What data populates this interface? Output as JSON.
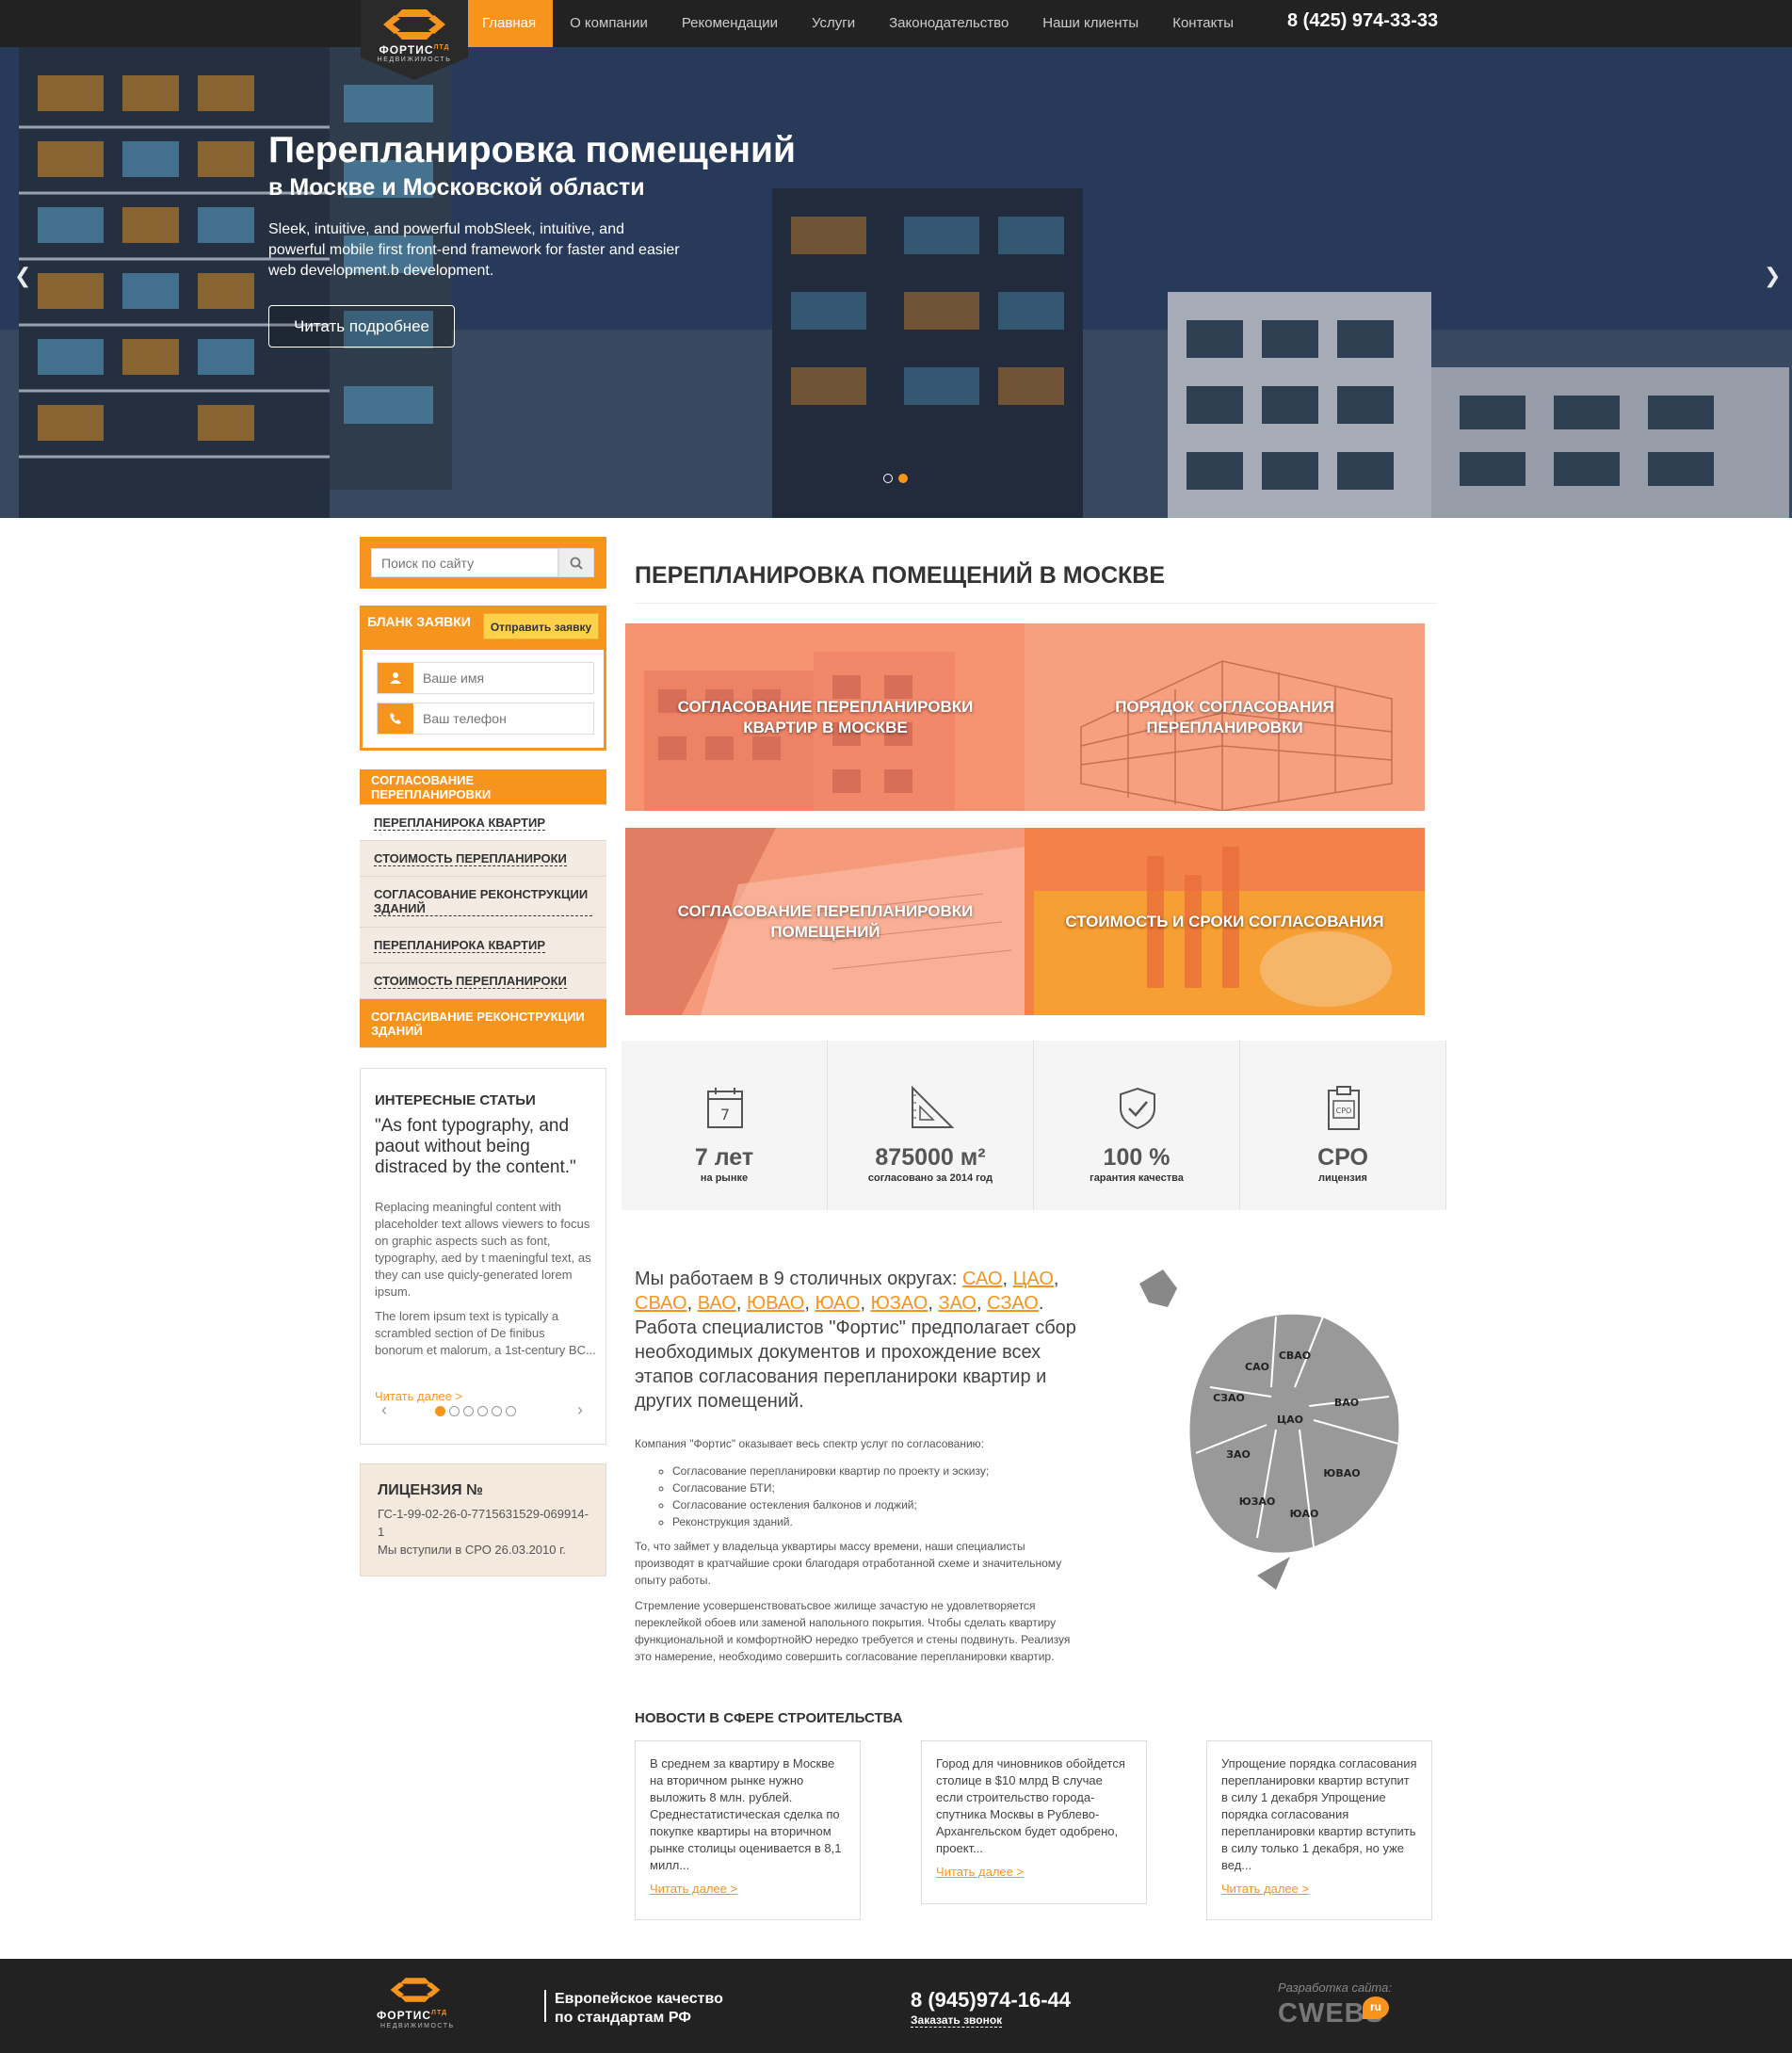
{
  "brand": {
    "name": "ФОРТИС",
    "suffix": "ЛТД",
    "sub": "НЕДВИЖИМОСТЬ",
    "accent": "#f7941d"
  },
  "nav": {
    "items": [
      "Главная",
      "О компании",
      "Рекомендации",
      "Услуги",
      "Законодательство",
      "Наши клиенты",
      "Контакты"
    ],
    "active": "Главная",
    "phone": "8 (425) 974-33-33"
  },
  "hero": {
    "title": "Перепланировка помещений",
    "subtitle": "в Москве и Московской области",
    "text": "Sleek, intuitive, and powerful mobSleek, intuitive, and powerful mobile first front-end framework for faster and easier web development.b development.",
    "button": "Читать подробнее"
  },
  "search": {
    "placeholder": "Поиск по сайту"
  },
  "order": {
    "title": "БЛАНК ЗАЯВКИ",
    "send": "Отправить заявку",
    "name_placeholder": "Ваше имя",
    "phone_placeholder": "Ваш телефон"
  },
  "menu": {
    "items": [
      {
        "label": "СОГЛАСОВАНИЕ ПЕРЕПЛАНИРОВКИ"
      },
      {
        "label": "ПЕРЕПЛАНИРОКА КВАРТИР"
      },
      {
        "label": "СТОИМОСТЬ ПЕРЕПЛАНИРОКИ"
      },
      {
        "label": "СОГЛАСОВАНИЕ РЕКОНСТРУКЦИИ ЗДАНИЙ"
      },
      {
        "label": "ПЕРЕПЛАНИРОКА КВАРТИР"
      },
      {
        "label": "СТОИМОСТЬ ПЕРЕПЛАНИРОКИ"
      },
      {
        "label": "СОГЛАСИВАНИЕ РЕКОНСТРУКЦИИ ЗДАНИЙ"
      }
    ]
  },
  "articles": {
    "title": "ИНТЕРЕСНЫЕ СТАТЬИ",
    "quote": "\"As font typography, and paout without being distraced by the content.\"",
    "p1": "Replacing meaningful content with placeholder text allows viewers to focus on graphic aspects such as font, typography, aed by t maeningful text, as they can use quicly-generated lorem ipsum.",
    "p2": "The lorem ipsum text is typically a scrambled section of De finibus bonorum et malorum, a 1st-century BC...",
    "more": "Читать далее >"
  },
  "license": {
    "title": "ЛИЦЕНЗИЯ №",
    "number": "ГС-1-99-02-26-0-7715631529-069914-1",
    "joined": "Мы вступили в СРО 26.03.2010 г."
  },
  "main": {
    "title": "ПЕРЕПЛАНИРОВКА ПОМЕЩЕНИЙ В МОСКВЕ",
    "tiles": [
      "СОГЛАСОВАНИЕ ПЕРЕПЛАНИРОВКИ КВАРТИР В МОСКВЕ",
      "ПОРЯДОК СОГЛАСОВАНИЯ ПЕРЕПЛАНИРОВКИ",
      "СОГЛАСОВАНИЕ ПЕРЕПЛАНИРОВКИ ПОМЕЩЕНИЙ",
      "СТОИМОСТЬ И СРОКИ СОГЛАСОВАНИЯ"
    ]
  },
  "stats": [
    {
      "icon": "calendar-icon",
      "icon_text": "7",
      "value": "7 лет",
      "label": "на рынке"
    },
    {
      "icon": "set-square-icon",
      "icon_text": "",
      "value": "875000 м²",
      "label": "согласовано за 2014 год"
    },
    {
      "icon": "shield-check-icon",
      "icon_text": "",
      "value": "100 %",
      "label": "гарантия качества"
    },
    {
      "icon": "clipboard-icon",
      "icon_text": "СРО",
      "value": "СРО",
      "label": "лицензия"
    }
  ],
  "districts": {
    "intro": "Мы работаем в 9 столичных округах: ",
    "list": [
      "САО",
      "ЦАО",
      "СВАО",
      "ВАО",
      "ЮВАО",
      "ЮАО",
      "ЮЗАО",
      "ЗАО",
      "СЗАО"
    ],
    "outro": ". Работа специалистов \"Фортис\" предполагает сбор необходимых документов и прохождение всех этапов согласования перепланироки квартир и других помещений."
  },
  "about": {
    "lead": "Компания \"Фортис\" оказывает весь спектр услуг по согласованию:",
    "bullets": [
      "Согласование перепланировки квартир по проекту и эскизу;",
      "Согласование БТИ;",
      "Согласование остекления балконов и лоджий;",
      "Реконструкция зданий."
    ],
    "p2": "То, что займет у владельца уквартиры массу времени, наши специалисты производят в кратчайшие сроки благодаря отработанной схеме и значительному опыту работы.",
    "p3": "Стремление усовершенствоватьсвое жилище зачастую не удовлетворяется переклейкой обоев или заменой напольного покрытия. Чтобы сделать квартиру функциональной и комфортнойЮ нередко требуется и стены подвинуть. Реализуя это намерение, необходимо совершить согласование перепланировки квартир."
  },
  "map": {
    "labels": [
      "САО",
      "СВАО",
      "СЗАО",
      "ВАО",
      "ЦАО",
      "ЗАО",
      "ЮВАО",
      "ЮЗАО",
      "ЮАО"
    ]
  },
  "news": {
    "title": "НОВОСТИ В СФЕРЕ СТРОИТЕЛЬСТВА",
    "items": [
      {
        "text": "В среднем за квартиру в Москве на вторичном рынке нужно выложить 8 млн. рублей. Среднестатистическая сделка по покупке квартиры на вторичном рынке столицы оценивается в 8,1 милл...",
        "more": "Читать далее >"
      },
      {
        "text": "Город для чиновников обойдется столице в $10 млрд В случае если строительство города-спутника Москвы в Рублево-Архангельском будет одобрено, проект...",
        "more": "Читать далее >"
      },
      {
        "text": "Упрощение порядка согласования перепланировки квартир вступит в силу 1 декабря Упрощение порядка согласования перепланировки квартир вступить в силу только 1 декабря, но уже вед...",
        "more": "Читать далее >"
      }
    ]
  },
  "footer": {
    "slogan_1": "Европейское качество",
    "slogan_2": "по стандартам РФ",
    "phone": "8 (945)974-16-44",
    "call": "Заказать звонок",
    "dev_label": "Разработка сайта:",
    "dev_name": "CWEBS",
    "dev_tld": "ru"
  }
}
